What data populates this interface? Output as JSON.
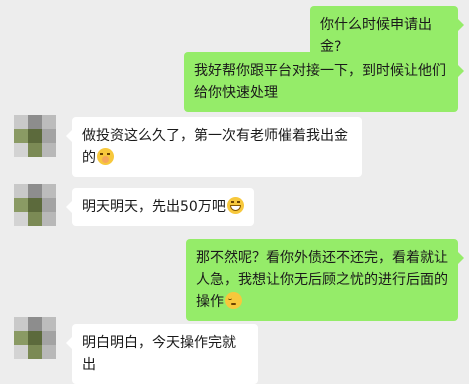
{
  "messages": [
    {
      "id": "m1",
      "side": "out",
      "text": "你什么时候申请出金?"
    },
    {
      "id": "m2",
      "side": "out",
      "text": "我好帮你跟平台对接一下，到时候让他们给你快速处理"
    },
    {
      "id": "m3",
      "side": "in",
      "text": "做投资这么久了，第一次有老师催着我出金的",
      "emoji": "embarrassed-laugh-emoji"
    },
    {
      "id": "m4",
      "side": "in",
      "text": "明天明天，先出50万吧",
      "emoji": "grinning-emoji"
    },
    {
      "id": "m5",
      "side": "out",
      "text": "那不然呢？看你外债还不还完，看着就让人急，我想让你无后顾之忧的进行后面的操作",
      "emoji": "relieved-emoji"
    },
    {
      "id": "m6",
      "side": "in",
      "text": "明白明白，今天操作完就出"
    }
  ],
  "colors": {
    "background": "#ededed",
    "outgoing_bubble": "#95ec69",
    "incoming_bubble": "#ffffff"
  },
  "avatar": {
    "pattern": [
      "#c9c9c9",
      "#8d8d8d",
      "#bcbcbc",
      "#8a9a64",
      "#5c6a3c",
      "#a3a3a3",
      "#d3d3d3",
      "#7b8a55",
      "#b8b8b8"
    ]
  }
}
